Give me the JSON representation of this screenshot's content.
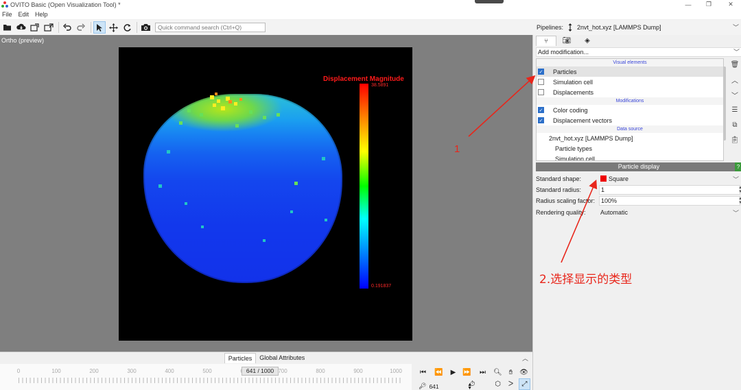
{
  "window": {
    "title": "OVITO Basic (Open Visualization Tool) *",
    "controls": [
      "—",
      "❐",
      "✕"
    ]
  },
  "menu": {
    "items": [
      "File",
      "Edit",
      "Help"
    ]
  },
  "toolbar": {
    "search_placeholder": "Quick command search (Ctrl+Q)",
    "icons": [
      "open-folder-icon",
      "cloud-download-icon",
      "export-icon",
      "export-image-icon",
      "undo-icon",
      "redo-icon",
      "select-mode-icon",
      "pan-mode-icon",
      "orbit-mode-icon",
      "render-icon"
    ]
  },
  "pipelines": {
    "label": "Pipelines:",
    "selected": "2nvt_hot.xyz [LAMMPS Dump]"
  },
  "viewport": {
    "caption": "Ortho (preview)",
    "legend": {
      "title": "Displacement Magnitude",
      "max": "38.5891",
      "min": "0.191837"
    }
  },
  "bottom_tabs": {
    "items": [
      "Particles",
      "Global Attributes"
    ],
    "active": "Particles"
  },
  "timeline": {
    "ticks": [
      "0",
      "100",
      "200",
      "300",
      "400",
      "500",
      "600",
      "700",
      "800",
      "900",
      "1000"
    ],
    "frame_display": "641 / 1000",
    "current_frame": "641"
  },
  "command_panel": {
    "add_modification": "Add modification...",
    "sections": {
      "visual": "Visual elements",
      "modifications": "Modifications",
      "data_source": "Data source"
    },
    "visual_elements": [
      {
        "label": "Particles",
        "checked": true,
        "selected": true
      },
      {
        "label": "Simulation cell",
        "checked": false,
        "selected": false
      },
      {
        "label": "Displacements",
        "checked": false,
        "selected": false
      }
    ],
    "modifications": [
      {
        "label": "Color coding",
        "checked": true
      },
      {
        "label": "Displacement vectors",
        "checked": true
      }
    ],
    "data_source": {
      "item": "2nvt_hot.xyz [LAMMPS Dump]",
      "sub_items": [
        "Particle types",
        "Simulation cell"
      ]
    }
  },
  "particle_display": {
    "header": "Particle display",
    "help": "?",
    "standard_shape_label": "Standard shape:",
    "standard_shape_value": "Square",
    "standard_radius_label": "Standard radius:",
    "standard_radius_value": "1",
    "radius_scaling_label": "Radius scaling factor:",
    "radius_scaling_value": "100%",
    "rendering_quality_label": "Rendering quality:",
    "rendering_quality_value": "Automatic"
  },
  "annotations": {
    "label1": "1",
    "label2": "2.选择显示的类型",
    "color": "#e8261b"
  }
}
